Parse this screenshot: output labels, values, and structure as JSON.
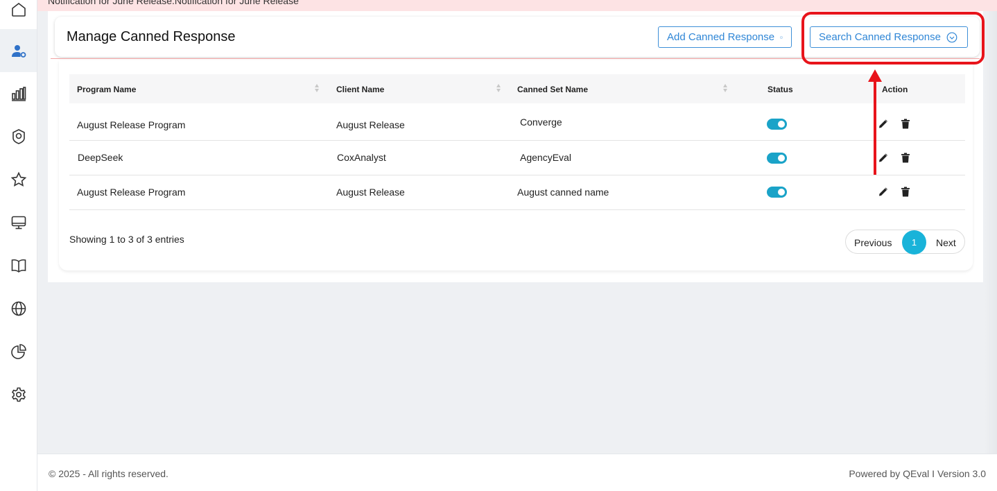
{
  "notification": "Notification for June Release.Notification for June Release",
  "sidebar": {
    "items": [
      {
        "icon": "home-icon"
      },
      {
        "icon": "user-settings-icon",
        "active": true
      },
      {
        "icon": "bar-chart-icon"
      },
      {
        "icon": "badge-icon"
      },
      {
        "icon": "star-icon"
      },
      {
        "icon": "monitor-icon"
      },
      {
        "icon": "book-icon"
      },
      {
        "icon": "globe-icon"
      },
      {
        "icon": "pie-chart-icon"
      },
      {
        "icon": "gear-icon"
      }
    ]
  },
  "header": {
    "title": "Manage Canned Response",
    "add_button": "Add Canned Response",
    "search_button": "Search Canned Response"
  },
  "table": {
    "columns": [
      "Program Name",
      "Client Name",
      "Canned Set Name",
      "Status",
      "Action"
    ],
    "rows": [
      {
        "program": "August Release Program",
        "client": "August Release",
        "canned_set": "Converge",
        "status": "on"
      },
      {
        "program": "DeepSeek",
        "client": "CoxAnalyst",
        "canned_set": "AgencyEval",
        "status": "on"
      },
      {
        "program": "August Release Program",
        "client": "August Release",
        "canned_set": "August canned name",
        "status": "on"
      }
    ],
    "info": "Showing 1 to 3 of 3 entries"
  },
  "pagination": {
    "previous": "Previous",
    "current_page": "1",
    "next": "Next"
  },
  "footer": {
    "copyright": "© 2025 - All rights reserved.",
    "powered": "Powered by QEval I Version 3.0"
  },
  "colors": {
    "accent": "#19b3d9",
    "button_border": "#3d8fd8",
    "annotation": "#e8141b",
    "banner": "#fde3e4"
  }
}
